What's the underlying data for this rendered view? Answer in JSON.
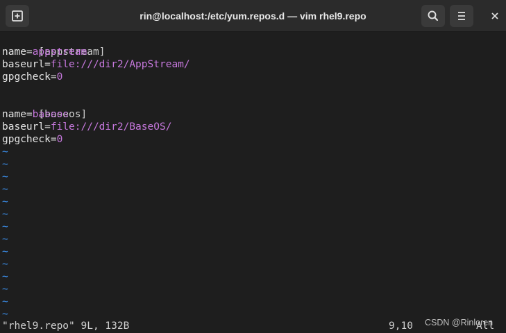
{
  "window": {
    "title": "rin@localhost:/etc/yum.repos.d — vim rhel9.repo"
  },
  "titlebar": {
    "new_tab_icon": "new-tab-icon",
    "search_icon": "search-icon",
    "menu_icon": "hamburger-menu-icon",
    "close_label": "×"
  },
  "editor": {
    "lines": [
      {
        "type": "section",
        "text": "[appstream]"
      },
      {
        "type": "kv",
        "key": "name",
        "eq": "=",
        "value": "appstream"
      },
      {
        "type": "kv",
        "key": "baseurl",
        "eq": "=",
        "value": "file:///dir2/AppStream/"
      },
      {
        "type": "kv",
        "key": "gpgcheck",
        "eq": "=",
        "value": "0"
      },
      {
        "type": "blank",
        "text": ""
      },
      {
        "type": "section",
        "text": "[baseos]"
      },
      {
        "type": "kv",
        "key": "name",
        "eq": "=",
        "value": "baseos"
      },
      {
        "type": "kv",
        "key": "baseurl",
        "eq": "=",
        "value": "file:///dir2/BaseOS/"
      },
      {
        "type": "kv",
        "key": "gpgcheck",
        "eq": "=",
        "value": "0"
      }
    ],
    "tilde": "~",
    "tilde_count": 14
  },
  "statusline": {
    "file_info": "\"rhel9.repo\" 9L, 132B",
    "cursor_pos": "9,10",
    "scroll": "All"
  },
  "watermark": "CSDN @Rinloren",
  "colors": {
    "value": "#c678dd",
    "tilde": "#3b8eea",
    "background": "#1e1e1e",
    "titlebar": "#2b2b2b"
  }
}
